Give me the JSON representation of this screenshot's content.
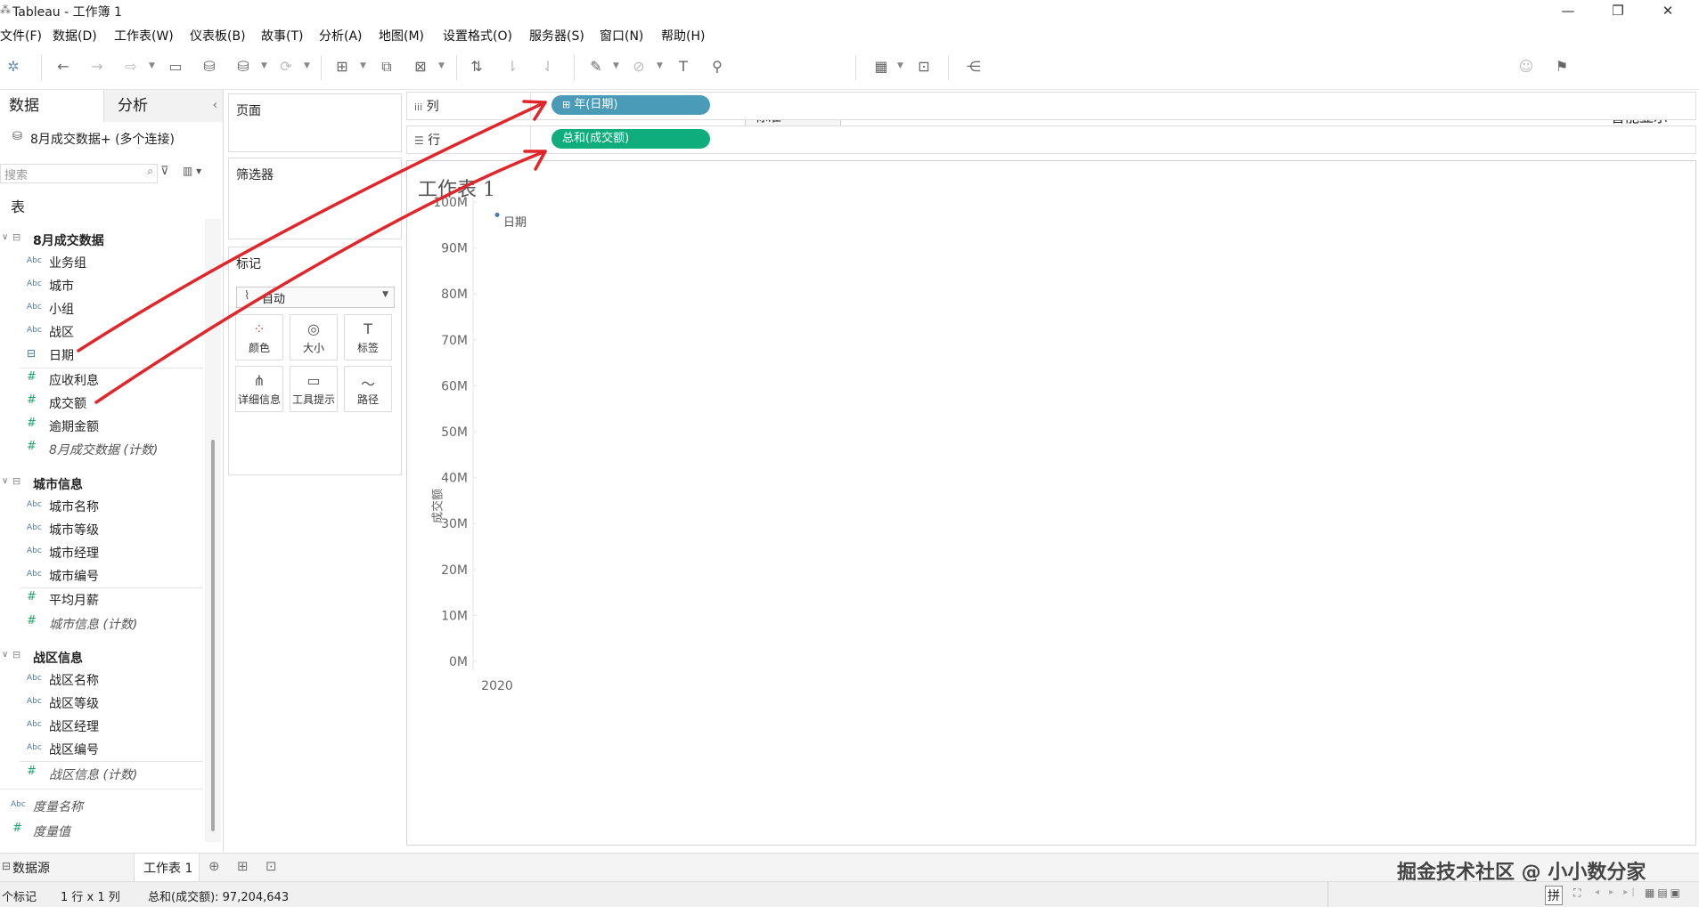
{
  "window": {
    "app_title": "Tableau - 工作簿 1",
    "min": "—",
    "restore": "❐",
    "close": "✕"
  },
  "menu": [
    "文件(F)",
    "数据(D)",
    "工作表(W)",
    "仪表板(B)",
    "故事(T)",
    "分析(A)",
    "地图(M)",
    "设置格式(O)",
    "服务器(S)",
    "窗口(N)",
    "帮助(H)"
  ],
  "toolbar": {
    "fit_value": "标准",
    "show_me_label": "智能显示"
  },
  "data_pane": {
    "tab_data": "数据",
    "tab_analysis": "分析",
    "connection": "8月成交数据+ (多个连接)",
    "search_placeholder": "搜索",
    "tables_heading": "表",
    "groups": [
      {
        "name": "8月成交数据",
        "fields": [
          {
            "type": "Abc",
            "name": "业务组"
          },
          {
            "type": "Abc",
            "name": "城市"
          },
          {
            "type": "Abc",
            "name": "小组"
          },
          {
            "type": "Abc",
            "name": "战区"
          },
          {
            "type": "date",
            "name": "日期"
          },
          {
            "type": "#",
            "name": "应收利息"
          },
          {
            "type": "#",
            "name": "成交额"
          },
          {
            "type": "#",
            "name": "逾期金额"
          },
          {
            "type": "#",
            "name": "8月成交数据 (计数)",
            "italic": true
          }
        ]
      },
      {
        "name": "城市信息",
        "fields": [
          {
            "type": "Abc",
            "name": "城市名称"
          },
          {
            "type": "Abc",
            "name": "城市等级"
          },
          {
            "type": "Abc",
            "name": "城市经理"
          },
          {
            "type": "Abc",
            "name": "城市编号"
          },
          {
            "type": "#",
            "name": "平均月薪"
          },
          {
            "type": "#",
            "name": "城市信息 (计数)",
            "italic": true
          }
        ]
      },
      {
        "name": "战区信息",
        "fields": [
          {
            "type": "Abc",
            "name": "战区名称"
          },
          {
            "type": "Abc",
            "name": "战区等级"
          },
          {
            "type": "Abc",
            "name": "战区经理"
          },
          {
            "type": "Abc",
            "name": "战区编号"
          },
          {
            "type": "#",
            "name": "战区信息 (计数)",
            "italic": true
          }
        ]
      }
    ],
    "extra_fields": [
      {
        "type": "Abc",
        "name": "度量名称",
        "italic": true
      },
      {
        "type": "#",
        "name": "度量值",
        "italic": true
      }
    ]
  },
  "cards": {
    "pages": "页面",
    "filters": "筛选器",
    "marks": "标记",
    "mark_type": "自动",
    "buttons": [
      "颜色",
      "大小",
      "标签",
      "详细信息",
      "工具提示",
      "路径"
    ]
  },
  "shelves": {
    "columns_label": "列",
    "rows_label": "行",
    "columns_pill": "年(日期)",
    "rows_pill": "总和(成交额)",
    "columns_color": "#4a9bb8",
    "rows_color": "#10ad7c"
  },
  "view": {
    "title": "工作表 1",
    "header": "日期"
  },
  "chart_data": {
    "type": "scatter",
    "x": [
      "2020"
    ],
    "y": [
      97204643
    ],
    "ylabel": "成交额",
    "xlabel": "",
    "ylim": [
      0,
      100000000
    ],
    "yticks": [
      "100M",
      "90M",
      "80M",
      "70M",
      "60M",
      "50M",
      "40M",
      "30M",
      "20M",
      "10M",
      "0M"
    ],
    "grid": false
  },
  "sheet_tabs": {
    "datasource": "数据源",
    "sheet": "工作表 1"
  },
  "status": {
    "marks": "个标记",
    "grid": "1 行 x 1 列",
    "sum": "总和(成交额): 97,204,643",
    "watermark": "掘金技术社区 @ 小小数分家",
    "ime": "拼"
  }
}
